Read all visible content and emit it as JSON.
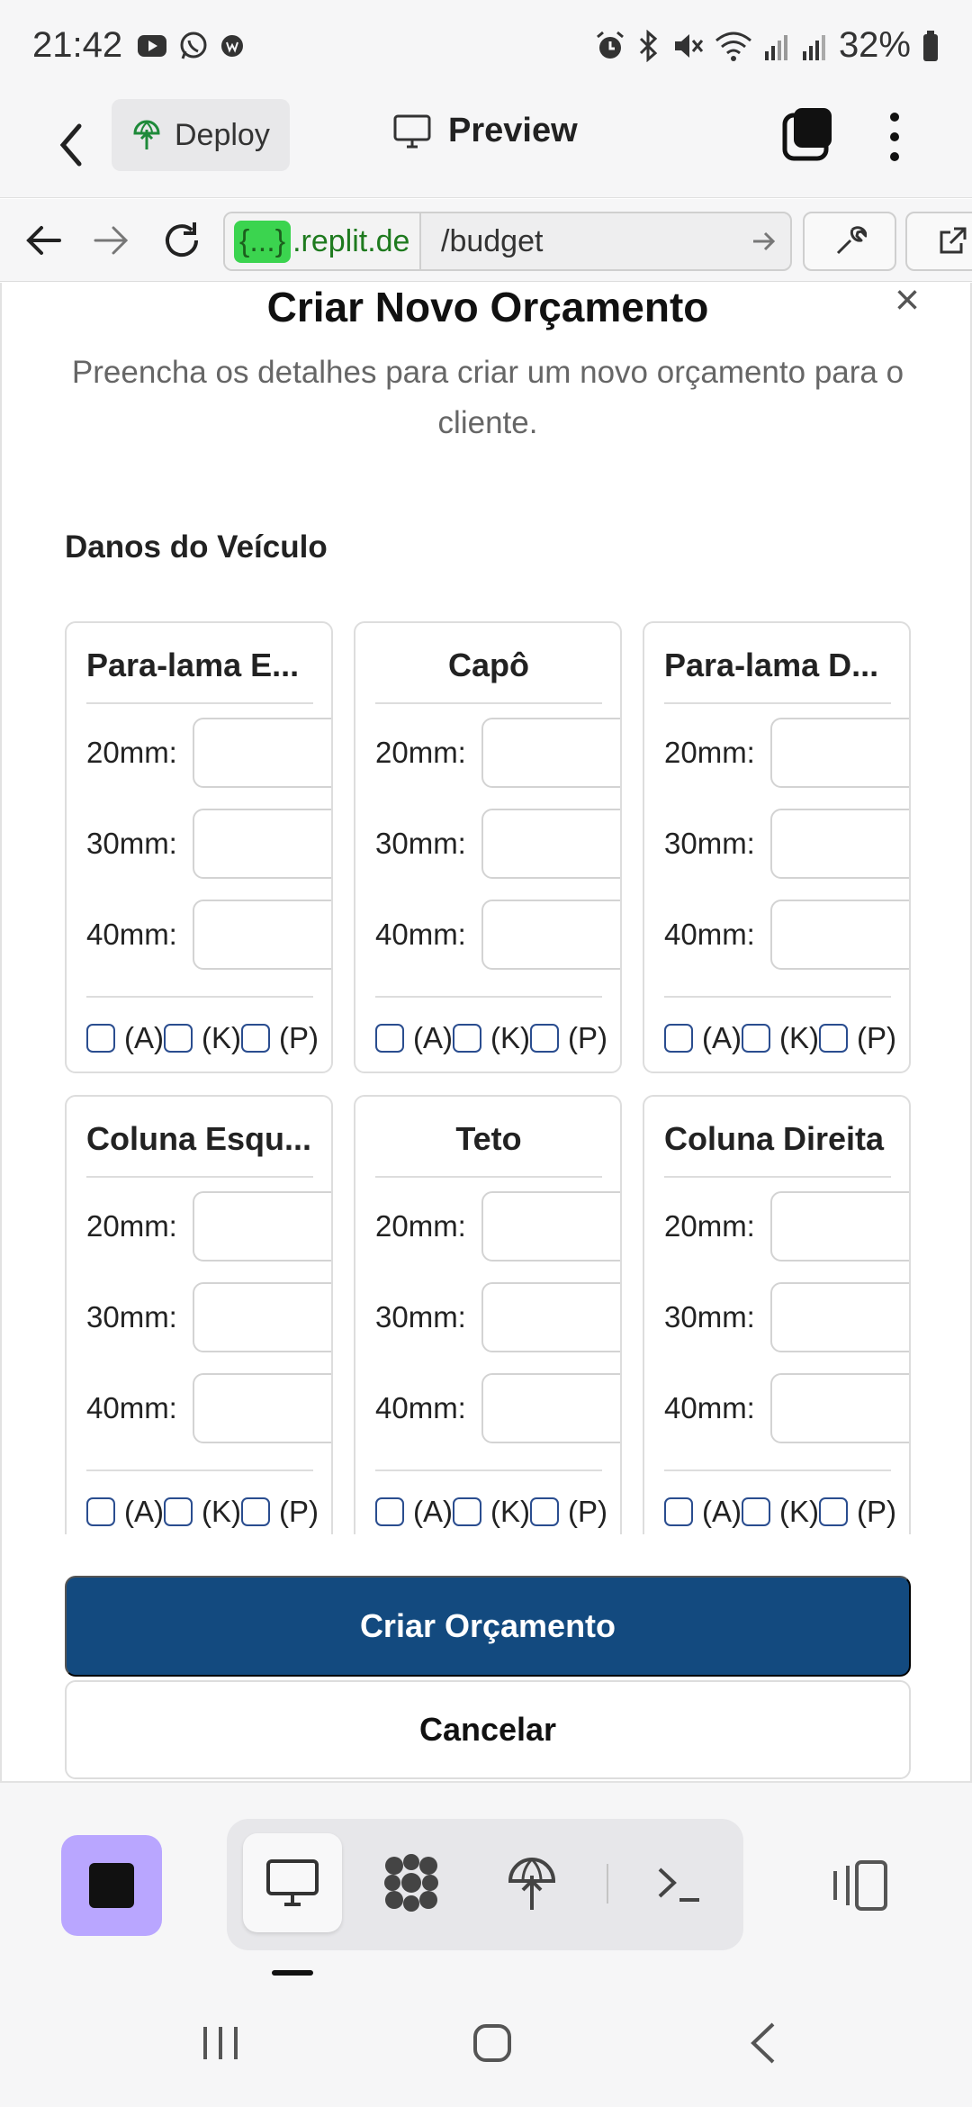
{
  "status_bar": {
    "time": "21:42",
    "battery": "32%",
    "icons": [
      "youtube-icon",
      "whatsapp-icon",
      "app-icon",
      "alarm-icon",
      "bluetooth-icon",
      "mute-icon",
      "wifi-icon",
      "signal-icon",
      "signal-icon-2",
      "battery-icon"
    ]
  },
  "app_bar": {
    "deploy_label": "Deploy",
    "preview_label": "Preview"
  },
  "url_bar": {
    "badge": "{...}",
    "domain": ".replit.de",
    "path": "/budget"
  },
  "modal": {
    "title": "Criar Novo Orçamento",
    "description": "Preencha os detalhes para criar um novo orçamento para o cliente.",
    "section_title": "Danos do Veículo",
    "close_symbol": "×"
  },
  "cards": [
    {
      "title": "Para-lama E...",
      "rows": [
        {
          "label": "20mm:",
          "value": ""
        },
        {
          "label": "30mm:",
          "value": ""
        },
        {
          "label": "40mm:",
          "value": ""
        }
      ],
      "options": [
        "(A)",
        "(K)",
        "(P)"
      ]
    },
    {
      "title": "Capô",
      "rows": [
        {
          "label": "20mm:",
          "value": ""
        },
        {
          "label": "30mm:",
          "value": ""
        },
        {
          "label": "40mm:",
          "value": ""
        }
      ],
      "options": [
        "(A)",
        "(K)",
        "(P)"
      ]
    },
    {
      "title": "Para-lama D...",
      "rows": [
        {
          "label": "20mm:",
          "value": ""
        },
        {
          "label": "30mm:",
          "value": ""
        },
        {
          "label": "40mm:",
          "value": ""
        }
      ],
      "options": [
        "(A)",
        "(K)",
        "(P)"
      ]
    },
    {
      "title": "Coluna Esqu...",
      "rows": [
        {
          "label": "20mm:",
          "value": ""
        },
        {
          "label": "30mm:",
          "value": ""
        },
        {
          "label": "40mm:",
          "value": ""
        }
      ],
      "options": [
        "(A)",
        "(K)",
        "(P)"
      ]
    },
    {
      "title": "Teto",
      "rows": [
        {
          "label": "20mm:",
          "value": ""
        },
        {
          "label": "30mm:",
          "value": ""
        },
        {
          "label": "40mm:",
          "value": ""
        }
      ],
      "options": [
        "(A)",
        "(K)",
        "(P)"
      ]
    },
    {
      "title": "Coluna Direita",
      "rows": [
        {
          "label": "20mm:",
          "value": ""
        },
        {
          "label": "30mm:",
          "value": ""
        },
        {
          "label": "40mm:",
          "value": ""
        }
      ],
      "options": [
        "(A)",
        "(K)",
        "(P)"
      ]
    }
  ],
  "actions": {
    "primary": "Criar Orçamento",
    "secondary": "Cancelar"
  },
  "colors": {
    "primary_button": "#134a7f",
    "stop_button": "#b9a6ff",
    "url_badge": "#3bd44f",
    "checkbox_border": "#2a4d8f"
  }
}
